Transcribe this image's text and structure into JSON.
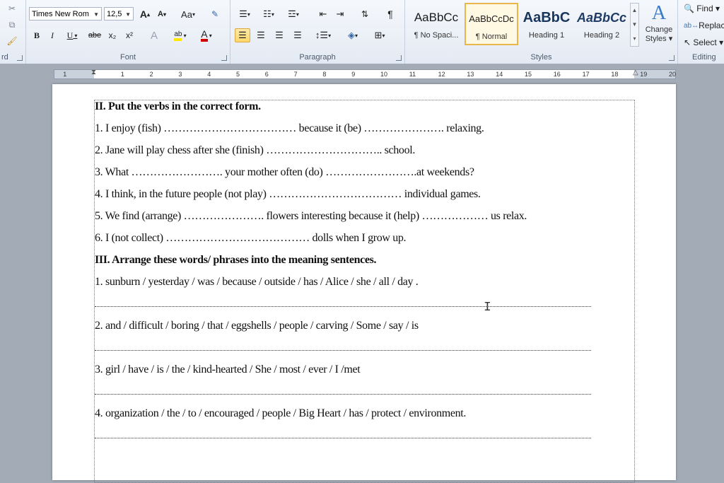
{
  "ribbon": {
    "font_group": {
      "label": "Font",
      "font_name": "Times New Rom",
      "font_size": "12,5",
      "grow": "A",
      "shrink": "A",
      "case": "Aa",
      "bold": "B",
      "italic": "I",
      "underline": "U",
      "strike": "abe",
      "subscript": "x₂",
      "superscript": "x²",
      "highlight": "ab",
      "font_color": "A"
    },
    "paragraph_group": {
      "label": "Paragraph",
      "show_marks": "¶"
    },
    "styles_group": {
      "label": "Styles",
      "tiles": [
        {
          "preview": "AaBbCc",
          "name": "¶ No Spaci..."
        },
        {
          "preview": "AaBbCcDc",
          "name": "¶ Normal"
        },
        {
          "preview": "AaBbC",
          "name": "Heading 1"
        },
        {
          "preview": "AaBbCc",
          "name": "Heading 2"
        }
      ],
      "change_styles_line1": "Change",
      "change_styles_line2": "Styles ▾"
    },
    "editing_group": {
      "label": "Editing",
      "find": "Find ▾",
      "replace": "Replace",
      "select": "Select ▾"
    },
    "clipboard_fragment": "rd"
  },
  "ruler": {
    "numbers": [
      "1",
      "1",
      "2",
      "3",
      "4",
      "5",
      "6",
      "7",
      "8",
      "9",
      "10",
      "11",
      "12",
      "13",
      "14",
      "15",
      "16",
      "17",
      "18",
      "19",
      "20"
    ]
  },
  "document": {
    "lines": [
      {
        "text": "II. Put the verbs in the correct form.",
        "bold": true
      },
      {
        "text": "1. I enjoy (fish) ……………………………… because it (be) …………………. relaxing."
      },
      {
        "text": "2. Jane will play chess after she (finish) ………………………….. school."
      },
      {
        "text": "3. What ……………………. your mother often (do) …………………….at weekends?"
      },
      {
        "text": "4. I think, in the future people (not play) ……………………………… individual games."
      },
      {
        "text": "5. We find (arrange) …………………. flowers interesting because it (help) ……………… us relax."
      },
      {
        "text": "6. I (not collect) ………………………………… dolls when I grow up."
      },
      {
        "text": "III. Arrange these words/ phrases into the meaning sentences.",
        "bold": true
      },
      {
        "text": "1. sunburn / yesterday / was / because / outside / has / Alice / she / all / day ."
      },
      {
        "text": "2. and / difficult / boring / that / eggshells  / people / carving / Some / say / is"
      },
      {
        "text": "3. girl / have / is / the / kind-hearted /  She / most / ever / I /met"
      },
      {
        "text": "4. organization / the / to / encouraged / people /  Big Heart / has / protect / environment."
      }
    ]
  },
  "colors": {
    "ribbon_bg": "#e4eaf3",
    "app_bg": "#a3abb7",
    "active_border": "#e8b64d",
    "highlight": "#ffe600",
    "font_color": "#d00000"
  }
}
